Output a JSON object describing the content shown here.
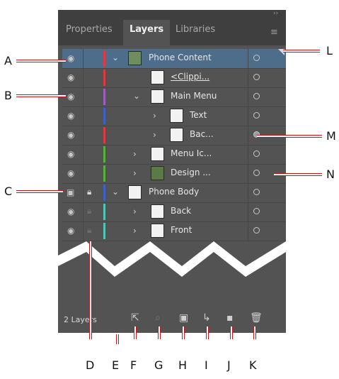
{
  "panel": {
    "collapse_glyph": "››",
    "tabs": [
      {
        "label": "Properties",
        "active": false
      },
      {
        "label": "Layers",
        "active": true
      },
      {
        "label": "Libraries",
        "active": false
      }
    ],
    "menu_icon": "hamburger-menu-icon",
    "footer": {
      "layer_count": "2 Layers",
      "icons": [
        "collect-for-export-icon",
        "locate-object-icon",
        "make-clipping-mask-icon",
        "create-new-sublayer-icon",
        "create-new-layer-icon",
        "delete-selection-icon"
      ]
    }
  },
  "colors": {
    "panel_bg": "#535353",
    "tabbar_bg": "#3f3f3f",
    "selected_row": "#4d6d8a",
    "callout_red": "#c4141c",
    "red_layer": "#e0393e",
    "purple_layer": "#9b5fc0",
    "blue_layer": "#3b62c6",
    "green_layer": "#58b33a",
    "teal_layer": "#4fc7b4"
  },
  "layers": [
    {
      "name": "Phone Content",
      "expanded": true,
      "selected": true,
      "color": "#e0393e"
    },
    {
      "name": "<Clippi...",
      "underlined": true,
      "color": "#e0393e"
    },
    {
      "name": "Main Menu",
      "expanded": true,
      "color": "#9b5fc0"
    },
    {
      "name": "Text",
      "collapsed": true,
      "color": "#3b62c6"
    },
    {
      "name": "Bac...",
      "collapsed": true,
      "target_filled": true,
      "color": "#e0393e"
    },
    {
      "name": "Menu Ic...",
      "collapsed": true,
      "color": "#58b33a"
    },
    {
      "name": "Design ...",
      "collapsed": true,
      "color": "#58b33a"
    },
    {
      "name": "Phone Body",
      "expanded": true,
      "locked": true,
      "color": "#3b62c6"
    },
    {
      "name": "Back",
      "collapsed": true,
      "locked_dim": true,
      "color": "#4fc7b4"
    },
    {
      "name": "Front",
      "collapsed": true,
      "locked_dim": true,
      "color": "#4fc7b4"
    }
  ],
  "callouts": {
    "A": "A",
    "B": "B",
    "C": "C",
    "D": "D",
    "E": "E",
    "F": "F",
    "G": "G",
    "H": "H",
    "I": "I",
    "J": "J",
    "K": "K",
    "L": "L",
    "M": "M",
    "N": "N"
  }
}
